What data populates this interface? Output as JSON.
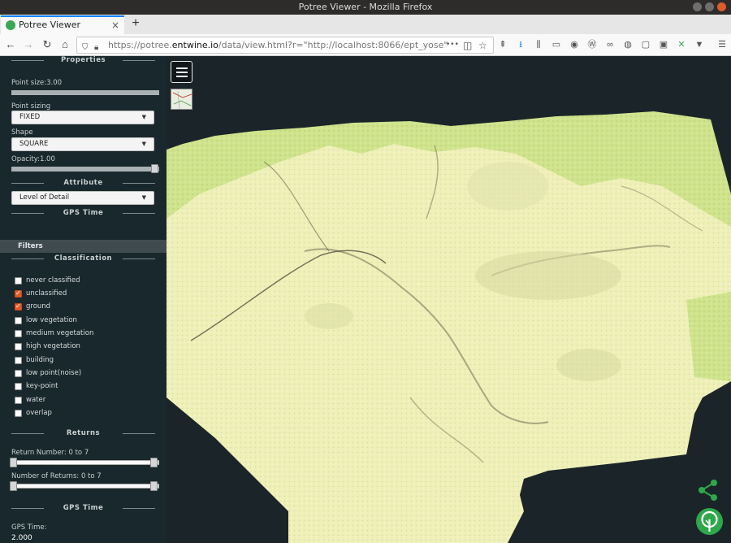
{
  "window": {
    "title": "Potree Viewer - Mozilla Firefox"
  },
  "tab": {
    "title": "Potree Viewer",
    "close": "×",
    "new_tab": "+"
  },
  "nav": {
    "back": "←",
    "forward": "→",
    "reload": "↻",
    "home": "⌂",
    "url_prefix": "https://potree.",
    "url_domain": "entwine.io",
    "url_rest": "/data/view.html?r=\"http://localhost:8066/ept_yose\"",
    "more": "•••"
  },
  "sidebar": {
    "properties": {
      "title": "Properties",
      "point_size_label": "Point size:3.00",
      "point_size": 3.0,
      "point_sizing_label": "Point sizing",
      "point_sizing_value": "FIXED",
      "shape_label": "Shape",
      "shape_value": "SQUARE",
      "opacity_label": "Opacity:1.00",
      "opacity": 1.0
    },
    "attribute": {
      "title": "Attribute",
      "value": "Level of Detail",
      "gps_time_title": "GPS Time"
    },
    "filters_label": "Filters",
    "classification": {
      "title": "Classification",
      "items": [
        {
          "label": "never classified",
          "checked": false
        },
        {
          "label": "unclassified",
          "checked": true
        },
        {
          "label": "ground",
          "checked": true
        },
        {
          "label": "low vegetation",
          "checked": false
        },
        {
          "label": "medium vegetation",
          "checked": false
        },
        {
          "label": "high vegetation",
          "checked": false
        },
        {
          "label": "building",
          "checked": false
        },
        {
          "label": "low point(noise)",
          "checked": false
        },
        {
          "label": "key-point",
          "checked": false
        },
        {
          "label": "water",
          "checked": false
        },
        {
          "label": "overlap",
          "checked": false
        }
      ]
    },
    "returns": {
      "title": "Returns",
      "return_number_label": "Return Number: 0 to 7",
      "number_of_returns_label": "Number of Returns: 0 to 7"
    },
    "gps": {
      "title": "GPS Time",
      "label": "GPS Time:",
      "value": "2.000"
    }
  },
  "colors": {
    "accent": "#0a84ff",
    "sidebar_bg": "#19282c",
    "checkbox_checked": "#e35b2a",
    "terrain_sand": "#eef0b8",
    "terrain_green": "#cfe38c",
    "brand_green": "#2ea84a"
  }
}
